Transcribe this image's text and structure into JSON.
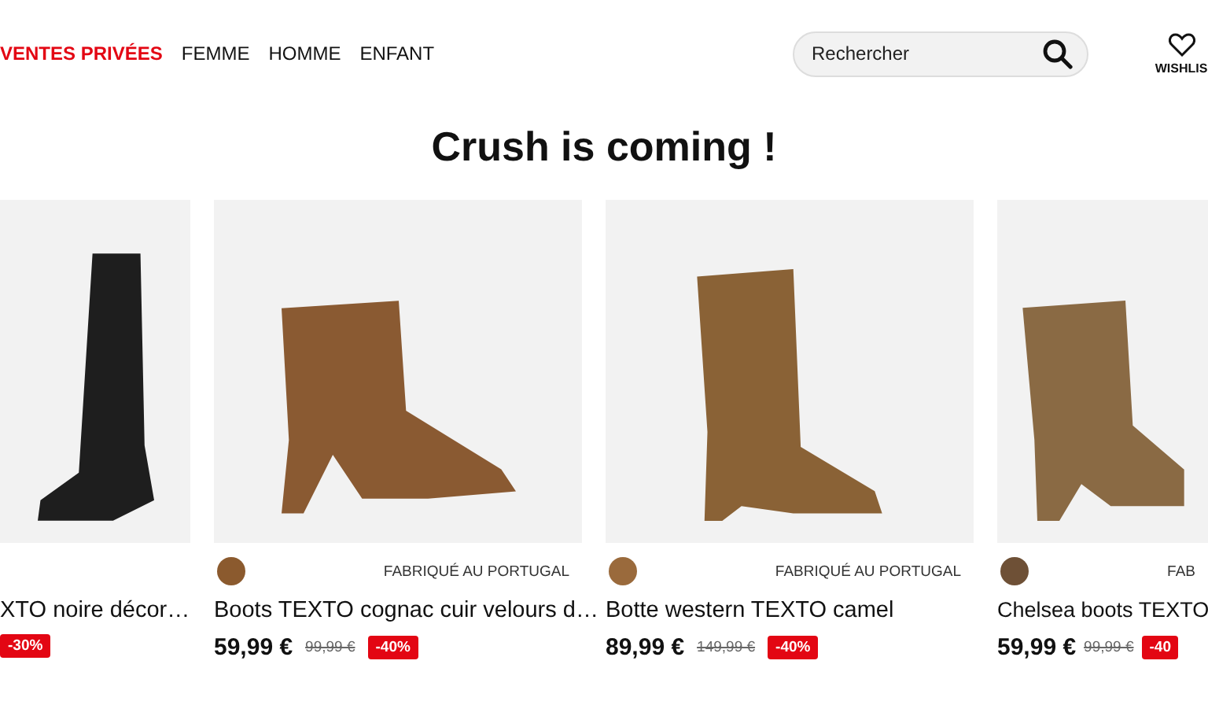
{
  "nav": {
    "items": [
      {
        "label": "VENTES PRIVÉES",
        "kind": "highlight"
      },
      {
        "label": "FEMME",
        "kind": "plain"
      },
      {
        "label": "HOMME",
        "kind": "plain"
      },
      {
        "label": "ENFANT",
        "kind": "plain"
      }
    ],
    "search": {
      "placeholder": "Rechercher"
    },
    "wishlist": {
      "label": "WISHLIS"
    }
  },
  "heading": "Crush is coming !",
  "products": [
    {
      "kind": "tall",
      "name": "XTO noire décor…",
      "badge": "-30%"
    },
    {
      "kind": "ankle",
      "color": "#8b5a2e",
      "origin": "FABRIQUÉ AU PORTUGAL",
      "name": "Boots TEXTO cognac cuir velours d…",
      "price": "59,99 €",
      "old_price": "99,99 €",
      "badge": "-40%"
    },
    {
      "kind": "western",
      "color": "#9a6a3c",
      "origin": "FABRIQUÉ AU PORTUGAL",
      "name": "Botte western TEXTO camel",
      "price": "89,99 €",
      "old_price": "149,99 €",
      "badge": "-40%"
    },
    {
      "kind": "chelsea",
      "color": "#6e5036",
      "origin": "FAB",
      "name": "Chelsea boots TEXTO",
      "price": "59,99 €",
      "old_price": "99,99 €",
      "badge": "-40"
    }
  ]
}
